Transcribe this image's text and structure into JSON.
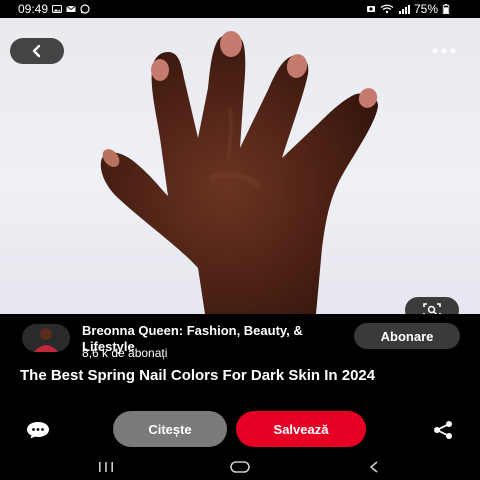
{
  "status_bar": {
    "time": "09:49",
    "battery": "75%",
    "left_icons": [
      "image-notification-icon",
      "mail-icon",
      "whatsapp-icon"
    ],
    "right_icons": [
      "screenshot-icon",
      "wifi-icon",
      "signal-icon",
      "battery-icon"
    ]
  },
  "pin": {
    "image_description_icon": "hand-photo",
    "toolbar": {
      "back_icon": "chevron-left-icon",
      "more_icon": "more-dots-icon",
      "lens_icon": "visual-search-icon"
    }
  },
  "creator": {
    "name": "Breonna Queen: Fashion, Beauty, & Lifestyle",
    "followers": "8,6 k de abonați",
    "follow_label": "Abonare"
  },
  "title": "The Best Spring Nail Colors For Dark Skin In 2024",
  "actions": {
    "read_label": "Citește",
    "save_label": "Salvează",
    "comment_icon": "comment-icon",
    "share_icon": "share-icon"
  },
  "colors": {
    "save_red": "#e60023",
    "read_gray": "#7a7a7a",
    "background": "#000000"
  },
  "nav_bar": {
    "recents_icon": "recents-icon",
    "home_icon": "home-icon",
    "back_icon": "back-icon"
  }
}
